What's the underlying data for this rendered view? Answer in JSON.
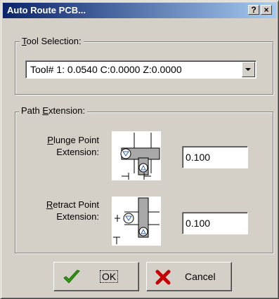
{
  "dialog": {
    "title": "Auto Route PCB...",
    "help_button": "?",
    "close_button": "×"
  },
  "tool_selection": {
    "group_label_first": "T",
    "group_label_rest": "ool Selection:",
    "selected_tool": "Tool# 1: 0.0540  C:0.0000  Z:0.0000"
  },
  "path_extension": {
    "group_label_pre": "Path ",
    "group_label_u": "E",
    "group_label_post": "xtension:",
    "plunge": {
      "label_line1_u": "P",
      "label_line1_rest": "lunge Point",
      "label_line2": "Extension:",
      "value": "0.100"
    },
    "retract": {
      "label_line1_u": "R",
      "label_line1_rest": "etract Point",
      "label_line2": "Extension:",
      "value": "0.100"
    }
  },
  "buttons": {
    "ok_label": "OK",
    "cancel_label": "Cancel"
  },
  "colors": {
    "title_gradient_start": "#0a246a",
    "title_gradient_end": "#a6caf0",
    "dialog_face": "#d4d0c8",
    "ok_check": "#2e9a12",
    "cancel_x": "#c40000"
  },
  "icons": [
    "help-icon",
    "close-icon",
    "dropdown-arrow-icon",
    "plunge-diagram-icon",
    "retract-diagram-icon",
    "checkmark-icon",
    "x-icon"
  ]
}
